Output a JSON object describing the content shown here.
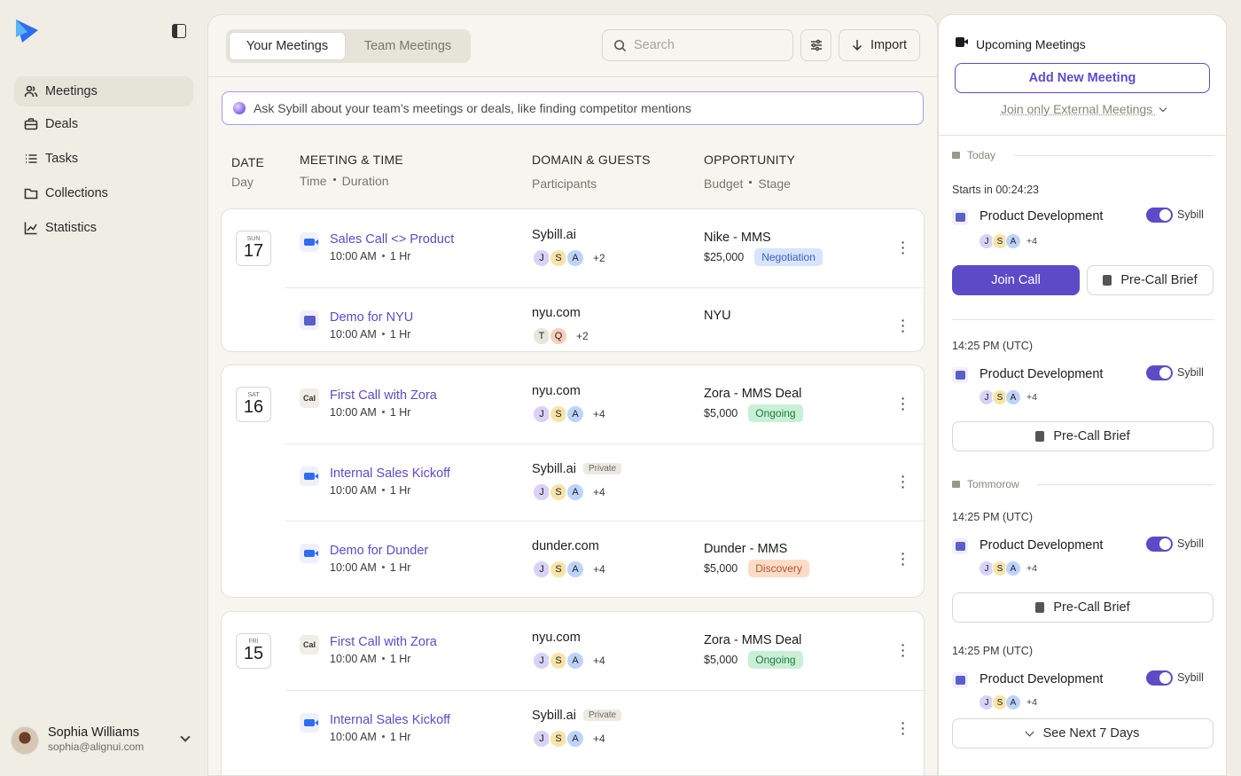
{
  "sidebar": {
    "items": [
      {
        "label": "Meetings",
        "icon": "users-icon"
      },
      {
        "label": "Deals",
        "icon": "briefcase-icon"
      },
      {
        "label": "Tasks",
        "icon": "list-icon"
      },
      {
        "label": "Collections",
        "icon": "folder-icon"
      },
      {
        "label": "Statistics",
        "icon": "chart-icon"
      }
    ],
    "user": {
      "name": "Sophia Williams",
      "email": "sophia@alignui.com"
    }
  },
  "toolbar": {
    "tabs": [
      "Your Meetings",
      "Team Meetings"
    ],
    "search_placeholder": "Search",
    "import_label": "Import"
  },
  "ask": {
    "placeholder": "Ask Sybill about your team’s meetings or deals, like finding competitor mentions"
  },
  "columns": {
    "date": "DATE",
    "date_sub": "Day",
    "meeting": "MEETING & TIME",
    "time": "Time",
    "duration": "Duration",
    "domain": "DOMAIN & GUESTS",
    "participants": "Participants",
    "opportunity": "OPPORTUNITY",
    "budget": "Budget",
    "stage": "Stage"
  },
  "days": [
    {
      "dow": "SUN",
      "day": "17",
      "meetings": [
        {
          "icon": "zoom-icon",
          "title": "Sales Call <> Product",
          "time": "10:00 AM",
          "duration": "1 Hr",
          "domain": "Sybill.ai",
          "guests": [
            "J",
            "S",
            "A"
          ],
          "more": "+2",
          "opp": "Nike - MMS",
          "budget": "$25,000",
          "stage": "Negotiation"
        },
        {
          "icon": "teams-icon",
          "title": "Demo for NYU",
          "time": "10:00 AM",
          "duration": "1 Hr",
          "domain": "nyu.com",
          "guests": [
            "T",
            "Q"
          ],
          "more": "+2",
          "opp": "NYU",
          "budget": "",
          "stage": ""
        }
      ]
    },
    {
      "dow": "SAT",
      "day": "16",
      "meetings": [
        {
          "icon": "cal-icon",
          "title": "First Call with Zora",
          "time": "10:00 AM",
          "duration": "1 Hr",
          "domain": "nyu.com",
          "guests": [
            "J",
            "S",
            "A"
          ],
          "more": "+4",
          "opp": "Zora - MMS Deal",
          "budget": "$5,000",
          "stage": "Ongoing"
        },
        {
          "icon": "zoom-icon",
          "title": "Internal Sales Kickoff",
          "time": "10:00 AM",
          "duration": "1 Hr",
          "domain": "Sybill.ai",
          "private": "Private",
          "guests": [
            "J",
            "S",
            "A"
          ],
          "more": "+4",
          "opp": "",
          "budget": "",
          "stage": ""
        },
        {
          "icon": "zoom-icon",
          "title": "Demo for Dunder",
          "time": "10:00 AM",
          "duration": "1 Hr",
          "domain": "dunder.com",
          "guests": [
            "J",
            "S",
            "A"
          ],
          "more": "+4",
          "opp": "Dunder - MMS",
          "budget": "$5,000",
          "stage": "Discovery"
        }
      ]
    },
    {
      "dow": "FRI",
      "day": "15",
      "meetings": [
        {
          "icon": "cal-icon",
          "title": "First Call with Zora",
          "time": "10:00 AM",
          "duration": "1 Hr",
          "domain": "nyu.com",
          "guests": [
            "J",
            "S",
            "A"
          ],
          "more": "+4",
          "opp": "Zora - MMS Deal",
          "budget": "$5,000",
          "stage": "Ongoing"
        },
        {
          "icon": "zoom-icon",
          "title": "Internal Sales Kickoff",
          "time": "10:00 AM",
          "duration": "1 Hr",
          "domain": "Sybill.ai",
          "private": "Private",
          "guests": [
            "J",
            "S",
            "A"
          ],
          "more": "+4",
          "opp": "",
          "budget": "",
          "stage": ""
        }
      ]
    }
  ],
  "upcoming": {
    "title": "Upcoming Meetings",
    "add_label": "Add New Meeting",
    "join_external": "Join only External Meetings",
    "today": "Today",
    "tomorrow": "Tommorow",
    "starts_in": "Starts in 00:24:23",
    "time_utc": "14:25 PM (UTC)",
    "meeting_name": "Product Development",
    "toggle_label": "Sybill",
    "guests": [
      "J",
      "S",
      "A"
    ],
    "more": "+4",
    "join_call": "Join Call",
    "pre_call": "Pre-Call Brief",
    "see_next": "See Next 7 Days"
  },
  "colors": {
    "accent": "#5c4bc7",
    "negotiation": "#cfe0ff",
    "ongoing": "#c9f0d6",
    "discovery": "#fcd8c0"
  }
}
